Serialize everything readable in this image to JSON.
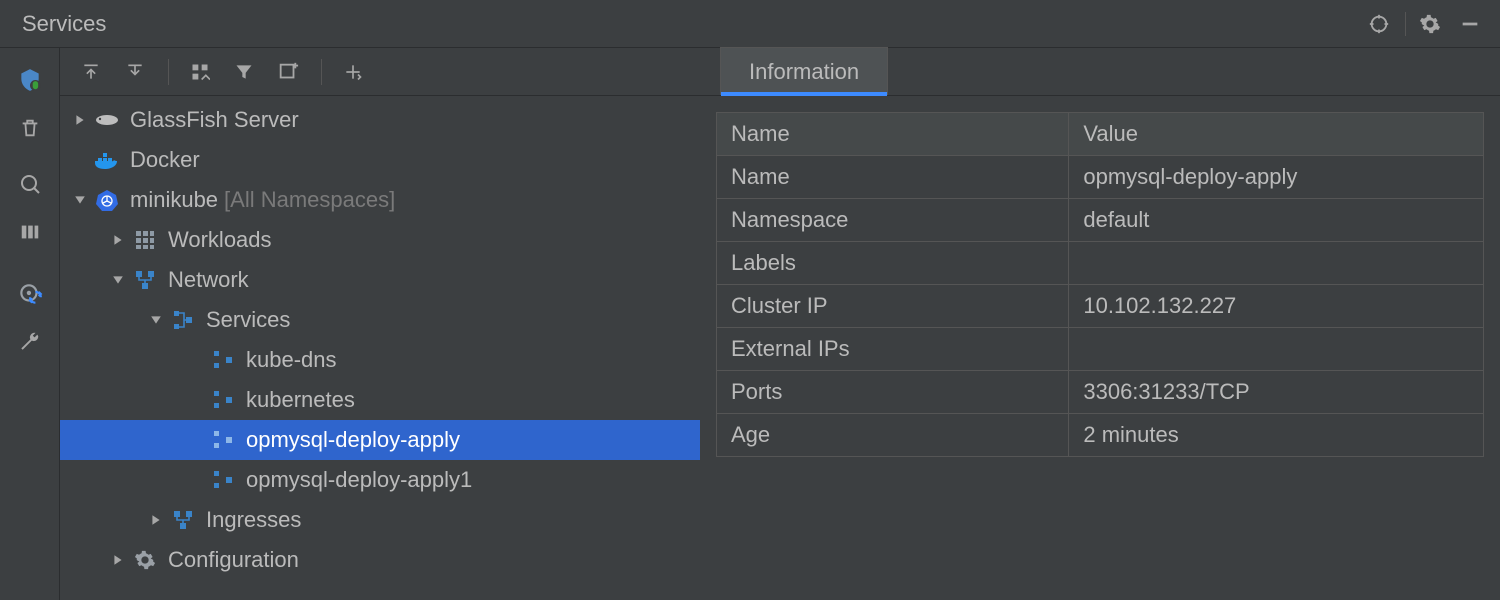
{
  "titlebar": {
    "title": "Services"
  },
  "tree": {
    "glassfish": {
      "label": "GlassFish Server"
    },
    "docker": {
      "label": "Docker"
    },
    "minikube": {
      "label": "minikube",
      "suffix": "[All Namespaces]"
    },
    "workloads": {
      "label": "Workloads"
    },
    "network": {
      "label": "Network"
    },
    "services": {
      "label": "Services"
    },
    "svc_kube_dns": {
      "label": "kube-dns"
    },
    "svc_kubernetes": {
      "label": "kubernetes"
    },
    "svc_opdeploy": {
      "label": "opmysql-deploy-apply"
    },
    "svc_opdeploy1": {
      "label": "opmysql-deploy-apply1"
    },
    "ingresses": {
      "label": "Ingresses"
    },
    "configuration": {
      "label": "Configuration"
    }
  },
  "details": {
    "tab_header": "Information",
    "columns": {
      "name": "Name",
      "value": "Value"
    },
    "rows": {
      "name": {
        "k": "Name",
        "v": "opmysql-deploy-apply"
      },
      "namespace": {
        "k": "Namespace",
        "v": "default"
      },
      "labels": {
        "k": "Labels",
        "v": ""
      },
      "cluster_ip": {
        "k": "Cluster IP",
        "v": "10.102.132.227"
      },
      "external_ips": {
        "k": "External IPs",
        "v": ""
      },
      "ports": {
        "k": "Ports",
        "v": "3306:31233/TCP"
      },
      "age": {
        "k": "Age",
        "v": "2 minutes"
      }
    }
  }
}
